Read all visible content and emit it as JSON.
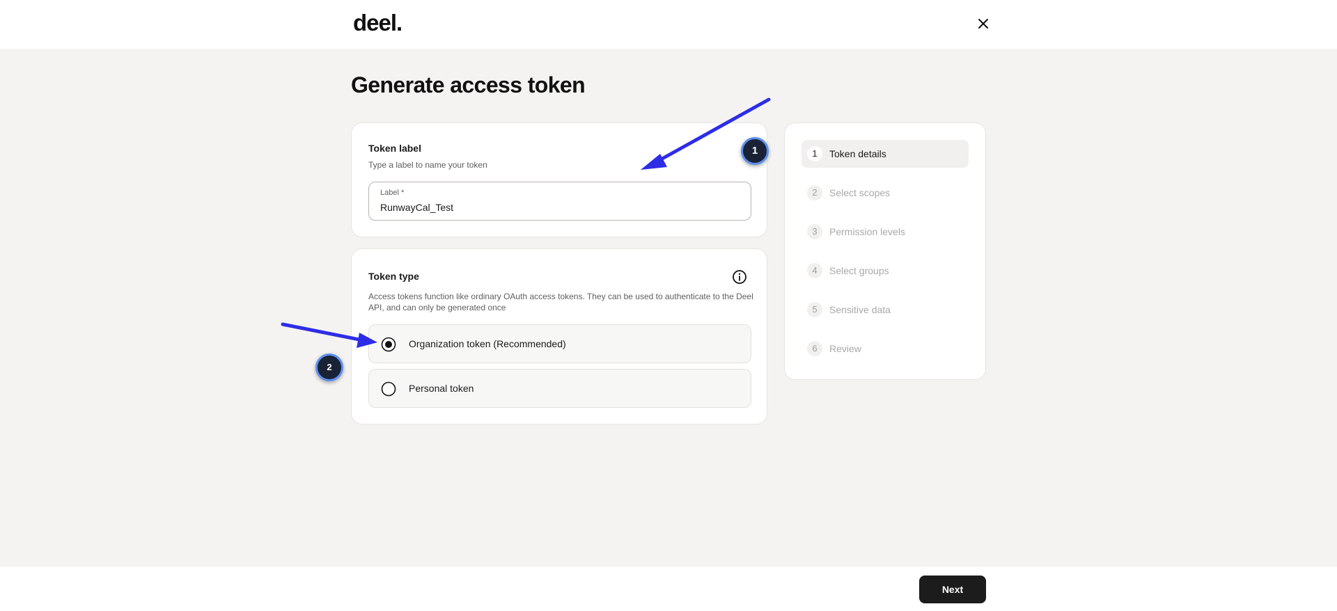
{
  "header": {
    "logo": "deel."
  },
  "page": {
    "title": "Generate access token"
  },
  "token_label_card": {
    "title": "Token label",
    "subtitle": "Type a label to name your token",
    "field": {
      "label": "Label *",
      "value": "RunwayCal_Test"
    }
  },
  "token_type_card": {
    "title": "Token type",
    "description": "Access tokens function like ordinary OAuth access tokens. They can be used to authenticate to the Deel API, and can only be generated once",
    "options": [
      {
        "label": "Organization token (Recommended)",
        "selected": true
      },
      {
        "label": "Personal token",
        "selected": false
      }
    ]
  },
  "steps": [
    {
      "num": "1",
      "label": "Token details",
      "active": true
    },
    {
      "num": "2",
      "label": "Select scopes",
      "active": false
    },
    {
      "num": "3",
      "label": "Permission levels",
      "active": false
    },
    {
      "num": "4",
      "label": "Select groups",
      "active": false
    },
    {
      "num": "5",
      "label": "Sensitive data",
      "active": false
    },
    {
      "num": "6",
      "label": "Review",
      "active": false
    }
  ],
  "footer": {
    "next_label": "Next"
  },
  "annotations": {
    "marker_1": "1",
    "marker_2": "2",
    "arrow_color": "#2d2de6"
  }
}
